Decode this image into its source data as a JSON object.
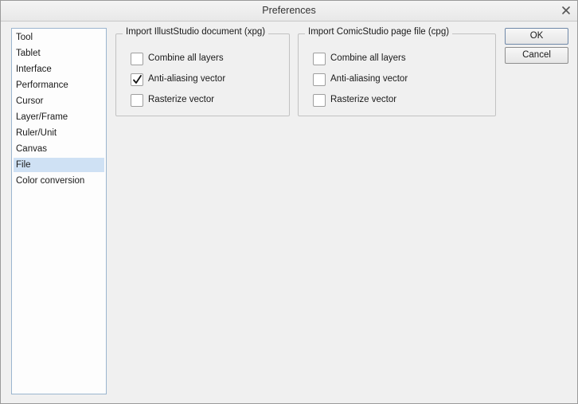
{
  "window": {
    "title": "Preferences"
  },
  "categories": [
    {
      "label": "Tool",
      "selected": false
    },
    {
      "label": "Tablet",
      "selected": false
    },
    {
      "label": "Interface",
      "selected": false
    },
    {
      "label": "Performance",
      "selected": false
    },
    {
      "label": "Cursor",
      "selected": false
    },
    {
      "label": "Layer/Frame",
      "selected": false
    },
    {
      "label": "Ruler/Unit",
      "selected": false
    },
    {
      "label": "Canvas",
      "selected": false
    },
    {
      "label": "File",
      "selected": true
    },
    {
      "label": "Color conversion",
      "selected": false
    }
  ],
  "import_xpg": {
    "legend": "Import IllustStudio document (xpg)",
    "options": [
      {
        "label": "Combine all layers",
        "checked": false
      },
      {
        "label": "Anti-aliasing vector",
        "checked": true
      },
      {
        "label": "Rasterize vector",
        "checked": false
      }
    ]
  },
  "import_cpg": {
    "legend": "Import ComicStudio page file (cpg)",
    "options": [
      {
        "label": "Combine all layers",
        "checked": false
      },
      {
        "label": "Anti-aliasing vector",
        "checked": false
      },
      {
        "label": "Rasterize vector",
        "checked": false
      }
    ]
  },
  "buttons": {
    "ok_label": "OK",
    "cancel_label": "Cancel"
  },
  "colors": {
    "selection": "#cfe1f4",
    "list_border": "#9bb5cf",
    "window_bg": "#f0f0f0"
  },
  "icons": {
    "close": "close-icon",
    "check": "checkmark-icon"
  }
}
